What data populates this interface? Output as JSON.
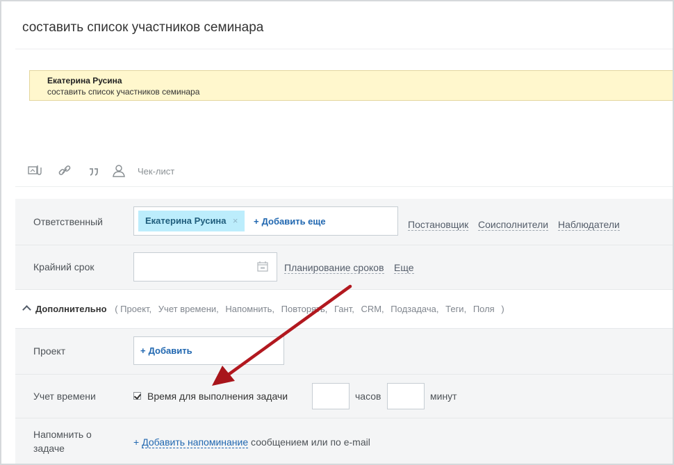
{
  "task": {
    "title": "составить список участников семинара"
  },
  "comment": {
    "author": "Екатерина Русина",
    "text": "составить список участников семинара"
  },
  "toolbar": {
    "checklist_label": "Чек-лист",
    "icons": [
      "attach-file-icon",
      "link-icon",
      "quote-icon",
      "mention-user-icon"
    ]
  },
  "responsible": {
    "label": "Ответственный",
    "chip_name": "Екатерина Русина",
    "chip_remove": "×",
    "add_more": "Добавить еще",
    "add_plus": "+",
    "role_links": [
      "Постановщик",
      "Соисполнители",
      "Наблюдатели"
    ]
  },
  "deadline": {
    "label": "Крайний срок",
    "value": "",
    "planning_link": "Планирование сроков",
    "more_link": "Еще"
  },
  "extra": {
    "title": "Дополнительно",
    "open_paren": "(",
    "close_paren": ")",
    "items": [
      "Проект,",
      "Учет времени,",
      "Напомнить,",
      "Повторять,",
      "Гант,",
      "CRM,",
      "Подзадача,",
      "Теги,",
      "Поля"
    ]
  },
  "project": {
    "label": "Проект",
    "add_plus": "+",
    "add_label": "Добавить"
  },
  "time_tracking": {
    "label": "Учет времени",
    "checkbox_checked": true,
    "checkbox_label": "Время для выполнения задачи",
    "hours_value": "",
    "hours_unit": "часов",
    "minutes_value": "",
    "minutes_unit": "минут"
  },
  "reminder": {
    "label_line1": "Напомнить о",
    "label_line2": "задаче",
    "plus": "+",
    "link": "Добавить напоминание",
    "suffix": " сообщением или по e-mail"
  },
  "colors": {
    "accent_link": "#2067b0",
    "chip_bg": "#bcedfc",
    "note_bg": "#fff7cd",
    "arrow": "#b3181f"
  }
}
